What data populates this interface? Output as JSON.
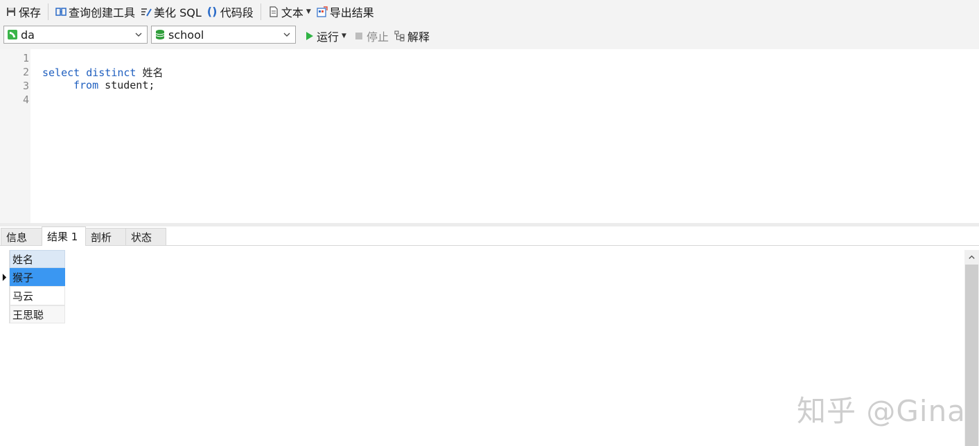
{
  "toolbar": {
    "save": "保存",
    "query_builder": "查询创建工具",
    "beautify": "美化 SQL",
    "snippet": "代码段",
    "text": "文本",
    "export": "导出结果"
  },
  "toolbar2": {
    "connection": "da",
    "database": "school",
    "run": "运行",
    "stop": "停止",
    "explain": "解释"
  },
  "editor": {
    "line_numbers": [
      "1",
      "2",
      "3",
      "4"
    ],
    "line2_kw1": "select",
    "line2_kw2": "distinct",
    "line2_rest": " 姓名",
    "line3_kw": "from",
    "line3_rest": " student;"
  },
  "tabs": [
    "信息",
    "结果 1",
    "剖析",
    "状态"
  ],
  "active_tab": "结果 1",
  "result": {
    "column": "姓名",
    "rows": [
      "猴子",
      "马云",
      "王思聪"
    ],
    "selected_row": 0
  },
  "watermark": "知乎 @Gina",
  "colors": {
    "keyword": "#1f5fbf",
    "selection": "#3a97f2",
    "run_green": "#2fb344",
    "db_green": "#2f9e3a"
  }
}
